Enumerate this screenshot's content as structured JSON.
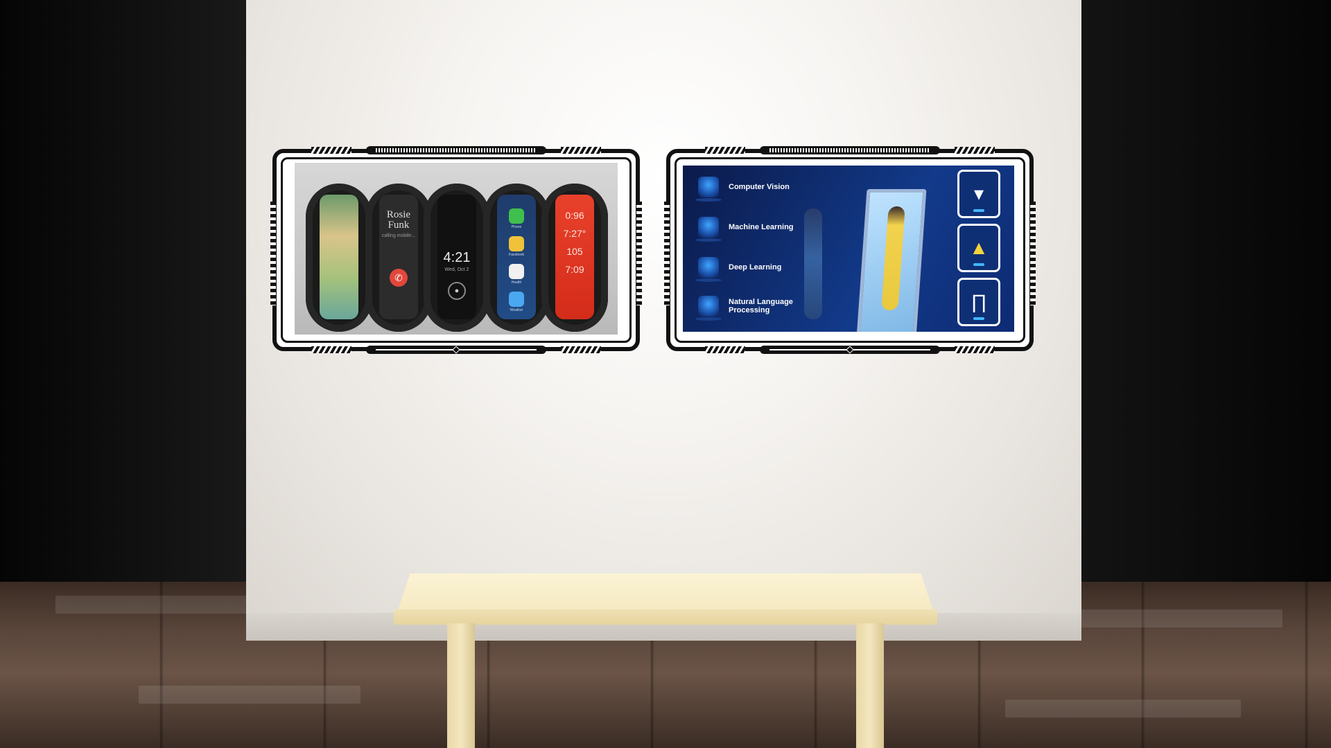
{
  "scene": {
    "name": "gallery-room",
    "colors": {
      "wall": "#f4f1ec",
      "bench": "#f3e6bb",
      "floor": "#5a463b",
      "frame": "#111111",
      "ai_bg": "#123a8a"
    }
  },
  "frames": [
    {
      "name": "smart-bands-display",
      "bands": [
        {
          "type": "photos"
        },
        {
          "type": "call",
          "name_line1": "Rosie",
          "name_line2": "Funk",
          "subtitle": "calling mobile..."
        },
        {
          "type": "time",
          "time": "4:21",
          "date": "Wed, Oct 2"
        },
        {
          "type": "apps",
          "apps": [
            "Phone",
            "Facebook",
            "Health",
            "Weather"
          ]
        },
        {
          "type": "weather",
          "lines": [
            "0:96",
            "7:27°",
            "105",
            "7:09"
          ]
        }
      ]
    },
    {
      "name": "ai-fashion-display",
      "items": [
        {
          "label": "Computer Vision",
          "icon": "server-icon"
        },
        {
          "label": "Machine Learning",
          "icon": "eye-icon"
        },
        {
          "label": "Deep Learning",
          "icon": "brain-icon"
        },
        {
          "label_line1": "Natural Language",
          "label_line2": "Processing",
          "icon": "language-icon"
        }
      ],
      "wardrobe": [
        {
          "item": "top",
          "icon": "shirt-icon"
        },
        {
          "item": "dress",
          "icon": "dress-icon"
        },
        {
          "item": "pants",
          "icon": "pants-icon"
        }
      ]
    }
  ]
}
